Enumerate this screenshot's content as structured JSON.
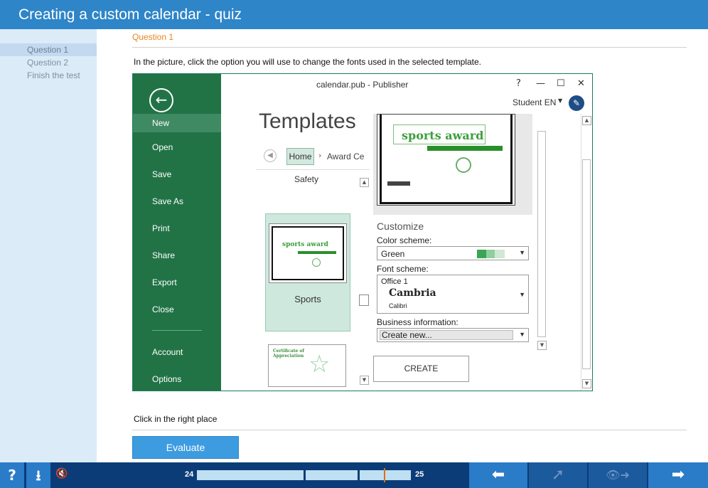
{
  "header": {
    "title": "Creating a custom calendar - quiz"
  },
  "sidebar": {
    "items": [
      {
        "label": "Question  1",
        "active": true
      },
      {
        "label": "Question  2",
        "active": false
      },
      {
        "label": "Finish the test",
        "active": false
      }
    ]
  },
  "question": {
    "title": "Question  1",
    "instruction": "In the picture, click the option you will use to change the fonts used in the selected template.",
    "hint": "Click in the right place",
    "evaluate_label": "Evaluate"
  },
  "publisher": {
    "window_title": "calendar.pub - Publisher",
    "help": "?",
    "account": "Student EN",
    "back_icon": "back-arrow-icon",
    "menu": [
      "New",
      "Open",
      "Save",
      "Save As",
      "Print",
      "Share",
      "Export",
      "Close"
    ],
    "menu_bottom": [
      "Account",
      "Options"
    ],
    "selected_menu": "New",
    "heading": "Templates",
    "breadcrumb_home": "Home",
    "breadcrumb_next": "Award Ce",
    "category": "Safety",
    "tile_label": "Sports",
    "tile_thumb_title": "sports award",
    "cert_thumb_title": "Certificate of Appreciation",
    "preview_title": "sports award",
    "customize": "Customize",
    "color_scheme_label": "Color scheme:",
    "color_scheme_value": "Green",
    "font_scheme_label": "Font scheme:",
    "font_scheme_name": "Office 1",
    "font_heading": "Cambria",
    "font_body": "Calibri",
    "business_label": "Business information:",
    "business_value": "Create new...",
    "create_label": "CREATE",
    "colors": {
      "green_dark": "#217346",
      "swatch_1": "#3aa557",
      "swatch_2": "#8fcf9d",
      "swatch_3": "#cfe9d4"
    }
  },
  "footer": {
    "help": "?",
    "progress_start": "24",
    "progress_end": "25",
    "progress_current_fraction": 0.67
  }
}
